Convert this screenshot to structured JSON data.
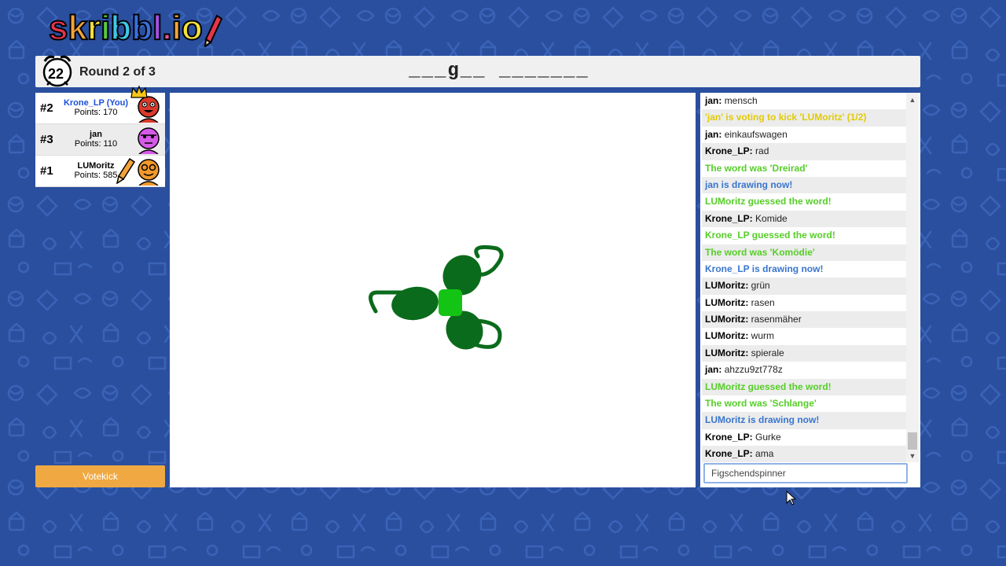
{
  "logo": {
    "letters": [
      {
        "ch": "s",
        "color": "#e8344a"
      },
      {
        "ch": "k",
        "color": "#f2a33a"
      },
      {
        "ch": "r",
        "color": "#f5e13a"
      },
      {
        "ch": "i",
        "color": "#58c93b"
      },
      {
        "ch": "b",
        "color": "#3fc7e6"
      },
      {
        "ch": "b",
        "color": "#3a6fe0"
      },
      {
        "ch": "l",
        "color": "#a64fe0"
      },
      {
        "ch": ".",
        "color": "#e8559a"
      },
      {
        "ch": "i",
        "color": "#f2a33a"
      },
      {
        "ch": "o",
        "color": "#f5e13a"
      }
    ]
  },
  "header": {
    "timer": "22",
    "round": "Round 2 of 3",
    "word_hint": "___g__ _______"
  },
  "players": [
    {
      "rank": "#2",
      "name": "Krone_LP (You)",
      "points": "Points: 170",
      "avatar_color": "#d93a2b",
      "crown": true,
      "drawing": false,
      "is_you": true
    },
    {
      "rank": "#3",
      "name": "jan",
      "points": "Points: 110",
      "avatar_color": "#d65ae8",
      "crown": false,
      "drawing": false,
      "is_you": false
    },
    {
      "rank": "#1",
      "name": "LUMoritz",
      "points": "Points: 585",
      "avatar_color": "#f2992c",
      "crown": false,
      "drawing": true,
      "is_you": false
    }
  ],
  "votekick_label": "Votekick",
  "chat": {
    "messages": [
      {
        "type": "user",
        "who": "jan:",
        "text": "mensch"
      },
      {
        "type": "yellow",
        "text": "'jan' is voting to kick 'LUMoritz' (1/2)"
      },
      {
        "type": "user",
        "who": "jan:",
        "text": "einkaufswagen"
      },
      {
        "type": "user",
        "who": "Krone_LP:",
        "text": "rad"
      },
      {
        "type": "green",
        "text": "The word was 'Dreirad'"
      },
      {
        "type": "blue",
        "text": "jan is drawing now!"
      },
      {
        "type": "green",
        "text": "LUMoritz guessed the word!"
      },
      {
        "type": "user",
        "who": "Krone_LP:",
        "text": "Komide"
      },
      {
        "type": "green",
        "text": "Krone_LP guessed the word!"
      },
      {
        "type": "green",
        "text": "The word was 'Komödie'"
      },
      {
        "type": "blue",
        "text": "Krone_LP is drawing now!"
      },
      {
        "type": "user",
        "who": "LUMoritz:",
        "text": "grün"
      },
      {
        "type": "user",
        "who": "LUMoritz:",
        "text": "rasen"
      },
      {
        "type": "user",
        "who": "LUMoritz:",
        "text": "rasenmäher"
      },
      {
        "type": "user",
        "who": "LUMoritz:",
        "text": "wurm"
      },
      {
        "type": "user",
        "who": "LUMoritz:",
        "text": "spierale"
      },
      {
        "type": "user",
        "who": "jan:",
        "text": "ahzzu9zt778z"
      },
      {
        "type": "green",
        "text": "LUMoritz guessed the word!"
      },
      {
        "type": "green",
        "text": "The word was 'Schlange'"
      },
      {
        "type": "blue",
        "text": "LUMoritz is drawing now!"
      },
      {
        "type": "user",
        "who": "Krone_LP:",
        "text": "Gurke"
      },
      {
        "type": "user",
        "who": "Krone_LP:",
        "text": "ama"
      }
    ],
    "input_value": "Figschendspinner"
  },
  "colors": {
    "background": "#2a4f9e",
    "message_green": "#56ce27",
    "message_blue": "#3975ce",
    "message_yellow": "#e2cb00",
    "votekick": "#f0a942",
    "drawing_dark_green": "#0b6b1c",
    "drawing_light_green": "#14c414"
  }
}
